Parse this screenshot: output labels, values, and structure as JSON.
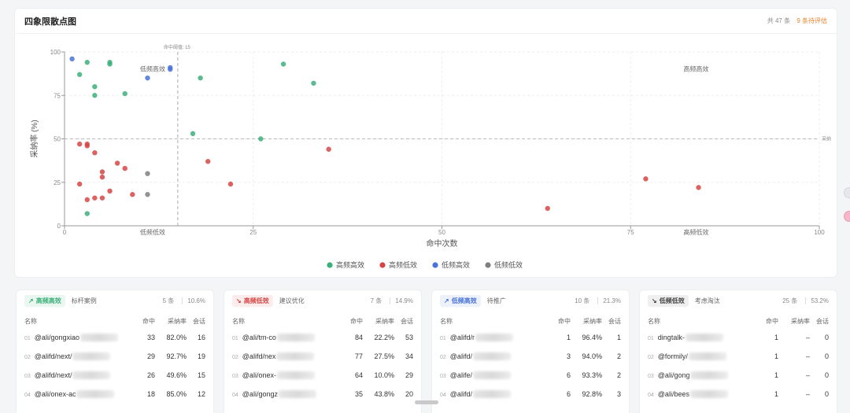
{
  "header": {
    "title": "四象限散点图",
    "total": "共 47 条",
    "pending": "9 条待评估"
  },
  "chart_data": {
    "type": "scatter",
    "xlabel": "命中次数",
    "ylabel": "采纳率 (%)",
    "xlim": [
      0,
      100
    ],
    "ylim": [
      0,
      100
    ],
    "x_ticks": [
      "0",
      "25",
      "50",
      "75",
      "100"
    ],
    "y_ticks": [
      "0",
      "25",
      "50",
      "75",
      "100"
    ],
    "threshold_x": 15,
    "threshold_x_label": "命中阈值: 15",
    "threshold_y": 50,
    "threshold_y_label": "采纳",
    "quadrant_labels": {
      "top_left": "低频高效",
      "top_right": "高频高效",
      "bottom_left": "低频低效",
      "bottom_right": "高频低效"
    },
    "legend_position": "bottom-center",
    "colors": {
      "high_freq_high_eff": "#3daf7a",
      "high_freq_low_eff": "#d64545",
      "low_freq_high_eff": "#4a72d8",
      "low_freq_low_eff": "#808080"
    },
    "series": [
      {
        "name": "高频高效",
        "color_key": "high_freq_high_eff",
        "points": [
          [
            3,
            94
          ],
          [
            6,
            93
          ],
          [
            6,
            94
          ],
          [
            2,
            87
          ],
          [
            4,
            80
          ],
          [
            4,
            75
          ],
          [
            8,
            76
          ],
          [
            29,
            93
          ],
          [
            18,
            85
          ],
          [
            33,
            82
          ],
          [
            17,
            53
          ],
          [
            26,
            50
          ],
          [
            3,
            7
          ]
        ]
      },
      {
        "name": "高频低效",
        "color_key": "high_freq_low_eff",
        "points": [
          [
            2,
            47
          ],
          [
            3,
            47
          ],
          [
            3,
            46
          ],
          [
            4,
            42
          ],
          [
            7,
            36
          ],
          [
            8,
            33
          ],
          [
            5,
            31
          ],
          [
            5,
            28
          ],
          [
            2,
            24
          ],
          [
            6,
            20
          ],
          [
            4,
            16
          ],
          [
            3,
            15
          ],
          [
            5,
            16
          ],
          [
            9,
            18
          ],
          [
            19,
            37
          ],
          [
            22,
            24
          ],
          [
            35,
            44
          ],
          [
            64,
            10
          ],
          [
            77,
            27
          ],
          [
            84,
            22
          ]
        ]
      },
      {
        "name": "低频高效",
        "color_key": "low_freq_high_eff",
        "points": [
          [
            1,
            96
          ],
          [
            11,
            85
          ],
          [
            14,
            91
          ],
          [
            14,
            90
          ]
        ]
      },
      {
        "name": "低频低效",
        "color_key": "low_freq_low_eff",
        "points": [
          [
            11,
            30
          ],
          [
            11,
            18
          ]
        ]
      }
    ]
  },
  "columns": {
    "name": "名称",
    "hits": "命中",
    "rate": "采纳率",
    "sessions": "会话"
  },
  "panels": [
    {
      "badge": "高频高效",
      "badge_icon": "trend-up-icon",
      "badge_color": "#3daf7a",
      "badge_bg": "#eaf7f0",
      "subtitle": "标杆案例",
      "count": "5 条",
      "percent": "10.6%",
      "rows": [
        {
          "rank": "01",
          "name": "@ali/gongxiao",
          "hits": "33",
          "rate": "82.0%",
          "sessions": "16"
        },
        {
          "rank": "02",
          "name": "@alifd/next/",
          "hits": "29",
          "rate": "92.7%",
          "sessions": "19"
        },
        {
          "rank": "03",
          "name": "@alifd/next/",
          "hits": "26",
          "rate": "49.6%",
          "sessions": "15"
        },
        {
          "rank": "04",
          "name": "@ali/onex-ac",
          "hits": "18",
          "rate": "85.0%",
          "sessions": "12"
        }
      ]
    },
    {
      "badge": "高频低效",
      "badge_icon": "trend-down-icon",
      "badge_color": "#d64545",
      "badge_bg": "#fcecec",
      "subtitle": "建议优化",
      "count": "7 条",
      "percent": "14.9%",
      "rows": [
        {
          "rank": "01",
          "name": "@ali/tm-co",
          "hits": "84",
          "rate": "22.2%",
          "sessions": "53"
        },
        {
          "rank": "02",
          "name": "@alifd/nex",
          "hits": "77",
          "rate": "27.5%",
          "sessions": "34"
        },
        {
          "rank": "03",
          "name": "@ali/onex-",
          "hits": "64",
          "rate": "10.0%",
          "sessions": "29"
        },
        {
          "rank": "04",
          "name": "@ali/gongz",
          "hits": "35",
          "rate": "43.8%",
          "sessions": "20"
        }
      ]
    },
    {
      "badge": "低频高效",
      "badge_icon": "arrow-up-right-icon",
      "badge_color": "#4a72d8",
      "badge_bg": "#ecf1fc",
      "subtitle": "待推广",
      "count": "10 条",
      "percent": "21.3%",
      "rows": [
        {
          "rank": "01",
          "name": "@alifd/r",
          "hits": "1",
          "rate": "96.4%",
          "sessions": "1"
        },
        {
          "rank": "02",
          "name": "@alifd/",
          "hits": "3",
          "rate": "94.0%",
          "sessions": "2"
        },
        {
          "rank": "03",
          "name": "@alife/",
          "hits": "6",
          "rate": "93.3%",
          "sessions": "2"
        },
        {
          "rank": "04",
          "name": "@alifd/",
          "hits": "6",
          "rate": "92.8%",
          "sessions": "3"
        }
      ]
    },
    {
      "badge": "低频低效",
      "badge_icon": "arrow-down-right-icon",
      "badge_color": "#444444",
      "badge_bg": "#efefef",
      "subtitle": "考虑淘汰",
      "count": "25 条",
      "percent": "53.2%",
      "rows": [
        {
          "rank": "01",
          "name": "dingtalk-",
          "hits": "1",
          "rate": "–",
          "sessions": "0"
        },
        {
          "rank": "02",
          "name": "@formily/",
          "hits": "1",
          "rate": "–",
          "sessions": "0"
        },
        {
          "rank": "03",
          "name": "@ali/gong",
          "hits": "1",
          "rate": "–",
          "sessions": "0"
        },
        {
          "rank": "04",
          "name": "@ali/bees",
          "hits": "1",
          "rate": "–",
          "sessions": "0"
        }
      ]
    }
  ]
}
